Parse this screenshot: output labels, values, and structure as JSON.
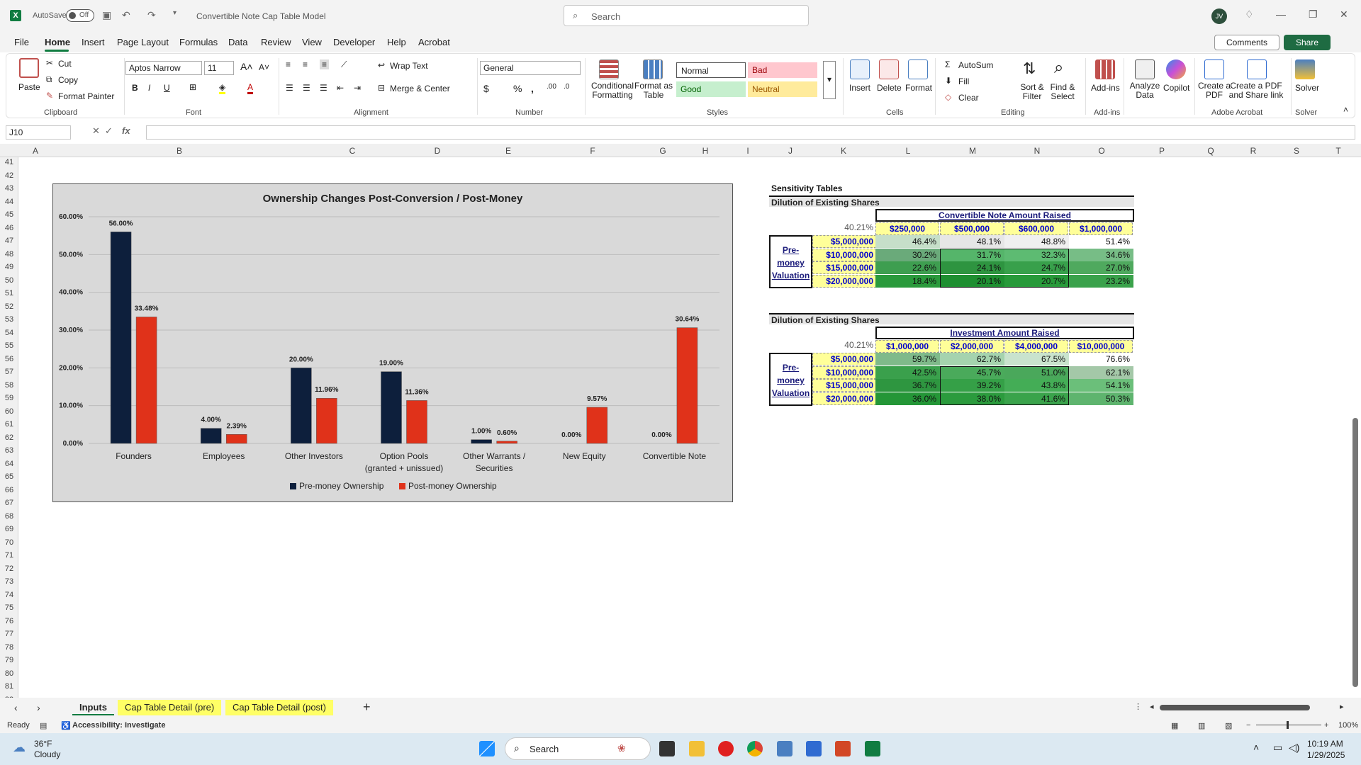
{
  "titlebar": {
    "autosave_label": "AutoSave",
    "autosave_state": "Off",
    "doc_title": "Convertible Note Cap Table Model",
    "search_placeholder": "Search",
    "avatar_initials": "JV"
  },
  "menu": [
    "File",
    "Home",
    "Insert",
    "Page Layout",
    "Formulas",
    "Data",
    "Review",
    "View",
    "Developer",
    "Help",
    "Acrobat"
  ],
  "menu_active": "Home",
  "comments_label": "Comments",
  "share_label": "Share",
  "ribbon": {
    "paste": "Paste",
    "cut": "Cut",
    "copy": "Copy",
    "format_painter": "Format Painter",
    "clipboard": "Clipboard",
    "font_name": "Aptos Narrow",
    "font_size": "11",
    "font": "Font",
    "wrap_text": "Wrap Text",
    "merge_center": "Merge & Center",
    "alignment": "Alignment",
    "number_format": "General",
    "number": "Number",
    "conditional_formatting": "Conditional Formatting",
    "format_as_table": "Format as Table",
    "style_normal": "Normal",
    "style_bad": "Bad",
    "style_good": "Good",
    "style_neutral": "Neutral",
    "styles": "Styles",
    "insert": "Insert",
    "delete": "Delete",
    "format": "Format",
    "cells": "Cells",
    "autosum": "AutoSum",
    "fill": "Fill",
    "clear": "Clear",
    "sort_filter": "Sort & Filter",
    "find_select": "Find & Select",
    "editing": "Editing",
    "addins": "Add-ins",
    "addins_group": "Add-ins",
    "analyze_data": "Analyze Data",
    "copilot": "Copilot",
    "create_pdf": "Create a PDF",
    "create_pdf_share": "Create a PDF and Share link",
    "adobe_acrobat": "Adobe Acrobat",
    "solver": "Solver",
    "solver_group": "Solver"
  },
  "formula_bar": {
    "name_box": "J10",
    "fx": "fx",
    "content": ""
  },
  "columns": [
    "A",
    "B",
    "C",
    "D",
    "E",
    "F",
    "G",
    "H",
    "I",
    "J",
    "K",
    "L",
    "M",
    "N",
    "O",
    "P",
    "Q",
    "R",
    "S",
    "T"
  ],
  "rows": [
    "41",
    "42",
    "43",
    "44",
    "45",
    "46",
    "47",
    "48",
    "49",
    "50",
    "51",
    "52",
    "53",
    "54",
    "55",
    "56",
    "57",
    "58",
    "59",
    "60",
    "61",
    "62",
    "63",
    "64",
    "65",
    "66",
    "67",
    "68",
    "69",
    "70",
    "71",
    "72",
    "73",
    "74",
    "75",
    "76",
    "77",
    "78",
    "79",
    "80",
    "81",
    "82"
  ],
  "chart_data": {
    "type": "bar",
    "title": "Ownership Changes Post-Conversion / Post-Money",
    "categories": [
      "Founders",
      "Employees",
      "Other Investors",
      "Option Pools (granted + unissued)",
      "Other Warrants / Securities",
      "New Equity",
      "Convertible Note"
    ],
    "series": [
      {
        "name": "Pre-money Ownership",
        "color": "#0d1f3c",
        "values": [
          56.0,
          4.0,
          20.0,
          19.0,
          1.0,
          0.0,
          0.0
        ],
        "labels": [
          "56.00%",
          "4.00%",
          "20.00%",
          "19.00%",
          "1.00%",
          "0.00%",
          "0.00%"
        ]
      },
      {
        "name": "Post-money Ownership",
        "color": "#e0321a",
        "values": [
          33.48,
          2.39,
          11.96,
          11.36,
          0.6,
          9.57,
          30.64
        ],
        "labels": [
          "33.48%",
          "2.39%",
          "11.96%",
          "11.36%",
          "0.60%",
          "9.57%",
          "30.64%"
        ]
      }
    ],
    "yticks": [
      "0.00%",
      "10.00%",
      "20.00%",
      "30.00%",
      "40.00%",
      "50.00%",
      "60.00%"
    ],
    "ylim": [
      0,
      60
    ],
    "grid": true,
    "legend": "bottom"
  },
  "sensitivity": {
    "title": "Sensitivity Tables",
    "table1": {
      "subtitle": "Dilution of Existing Shares",
      "header": "Convertible Note Amount Raised",
      "base": "40.21%",
      "cols": [
        "$250,000",
        "$500,000",
        "$600,000",
        "$1,000,000"
      ],
      "row_label": "Pre-money Valuation",
      "rows": [
        "$5,000,000",
        "$10,000,000",
        "$15,000,000",
        "$20,000,000"
      ],
      "values": [
        [
          "46.4%",
          "48.1%",
          "48.8%",
          "51.4%"
        ],
        [
          "30.2%",
          "31.7%",
          "32.3%",
          "34.6%"
        ],
        [
          "22.6%",
          "24.1%",
          "24.7%",
          "27.0%"
        ],
        [
          "18.4%",
          "20.1%",
          "20.7%",
          "23.2%"
        ]
      ],
      "colors": [
        [
          "#c6dfc9",
          "#e6e6e6",
          "#f0f0f0",
          "#ffffff"
        ],
        [
          "#6aaa7a",
          "#55b56a",
          "#5dbb72",
          "#77bd86"
        ],
        [
          "#3e9e50",
          "#2e9440",
          "#38a04b",
          "#4fa95e"
        ],
        [
          "#2a9a3c",
          "#1e8f31",
          "#289a3a",
          "#3aa24b"
        ]
      ]
    },
    "table2": {
      "subtitle": "Dilution of Existing Shares",
      "header": "Investment Amount Raised",
      "base": "40.21%",
      "cols": [
        "$1,000,000",
        "$2,000,000",
        "$4,000,000",
        "$10,000,000"
      ],
      "row_label": "Pre-money Valuation",
      "rows": [
        "$5,000,000",
        "$10,000,000",
        "$15,000,000",
        "$20,000,000"
      ],
      "values": [
        [
          "59.7%",
          "62.7%",
          "67.5%",
          "76.6%"
        ],
        [
          "42.5%",
          "45.7%",
          "51.0%",
          "62.1%"
        ],
        [
          "36.7%",
          "39.2%",
          "43.8%",
          "54.1%"
        ],
        [
          "36.0%",
          "38.0%",
          "41.6%",
          "50.3%"
        ]
      ],
      "colors": [
        [
          "#7fba8a",
          "#a5d3ae",
          "#c9e3cd",
          "#ffffff"
        ],
        [
          "#3aa04c",
          "#4aaa5b",
          "#4aa85b",
          "#a4c8a8"
        ],
        [
          "#2e9640",
          "#35a047",
          "#44ad56",
          "#6bbf7a"
        ],
        [
          "#249637",
          "#2b9b3d",
          "#3aa34b",
          "#5eb46e"
        ]
      ]
    }
  },
  "sheet_tabs": [
    "Inputs",
    "Cap Table Detail (pre)",
    "Cap Table Detail (post)"
  ],
  "status": {
    "ready": "Ready",
    "accessibility": "Accessibility: Investigate",
    "zoom": "100%"
  },
  "taskbar": {
    "temp": "36°F",
    "weather": "Cloudy",
    "search": "Search",
    "time": "10:19 AM",
    "date": "1/29/2025"
  }
}
